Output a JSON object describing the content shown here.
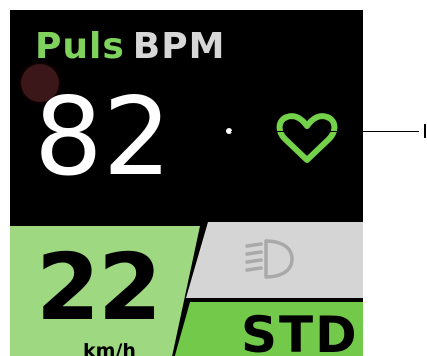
{
  "header": {
    "label_primary": "Puls",
    "label_secondary": "BPM"
  },
  "pulse": {
    "value": "82",
    "icon": "heart-icon"
  },
  "speed": {
    "value": "22",
    "unit": "km/h"
  },
  "light": {
    "icon": "headlight-icon"
  },
  "mode": {
    "value": "STD"
  },
  "colors": {
    "accent_green": "#7fd35d",
    "speed_panel": "#9ed880",
    "mode_panel": "#72c94a",
    "light_panel": "#d5d5d5",
    "heart_green": "#74d14a"
  }
}
